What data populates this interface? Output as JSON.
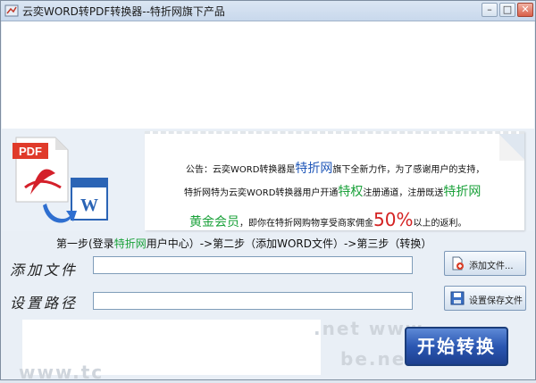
{
  "window": {
    "title": "云奕WORD转PDF转换器--特折网旗下产品",
    "min_label": "–",
    "max_label": "□",
    "close_label": "✕"
  },
  "banner": {
    "pdf_label": "PDF",
    "word_label": "W",
    "notice": {
      "l1_a": "公告：云奕WORD转换器是",
      "l1_b": "特折网",
      "l1_c": "旗下全新力作，为了感谢用户的支持，",
      "l2_a": "特折网特为云奕WORD转换器用户开通",
      "l2_b": "特权",
      "l2_c": "注册通道，注册既送",
      "l2_d": "特折网",
      "l3_a": "黄金会员",
      "l3_b": "，即你在特折网购物享受商家佣金",
      "l3_c": "50%",
      "l3_d": "以上的返利。"
    }
  },
  "steps": {
    "a": "第一步(登录",
    "b": "特折网",
    "c": "用户中心）->第二步（添加WORD文件）->第三步（转换）"
  },
  "form": {
    "add_file_label": "添加文件",
    "add_file_value": "",
    "save_path_label": "设置路径",
    "save_path_value": "",
    "add_file_button": "添加文件...",
    "save_path_button": "设置保存文件"
  },
  "watermark": {
    "w1": ".net www.",
    "w2": "be.net",
    "w3": "www.tc"
  },
  "start_button": "开始转换",
  "colors": {
    "accent_blue": "#1f56b8",
    "accent_green": "#1aa13a",
    "accent_red": "#d42222",
    "start_button": "#2b57b2"
  },
  "icons": {
    "app": "app-icon",
    "pdf": "pdf-icon",
    "word": "word-icon",
    "add_file": "add-file-icon",
    "save": "save-icon"
  }
}
